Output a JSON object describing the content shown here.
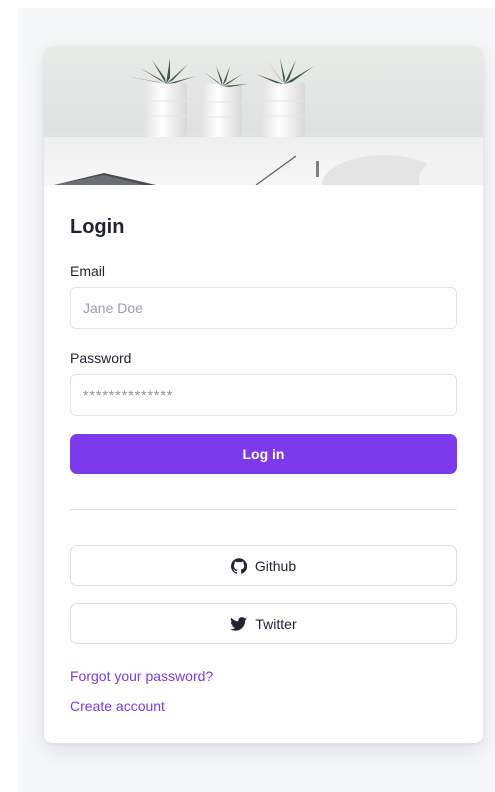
{
  "login": {
    "title": "Login",
    "email": {
      "label": "Email",
      "placeholder": "Jane Doe"
    },
    "password": {
      "label": "Password",
      "placeholder": "**************"
    },
    "submit_label": "Log in",
    "social": [
      {
        "label": "Github",
        "icon": "github-icon"
      },
      {
        "label": "Twitter",
        "icon": "twitter-icon"
      }
    ],
    "links": {
      "forgot_password": "Forgot your password?",
      "create_account": "Create account"
    }
  },
  "colors": {
    "accent": "#7c3aed",
    "text": "#1f2430",
    "border": "#e3e5ea",
    "page_background": "#f6f7f9"
  }
}
